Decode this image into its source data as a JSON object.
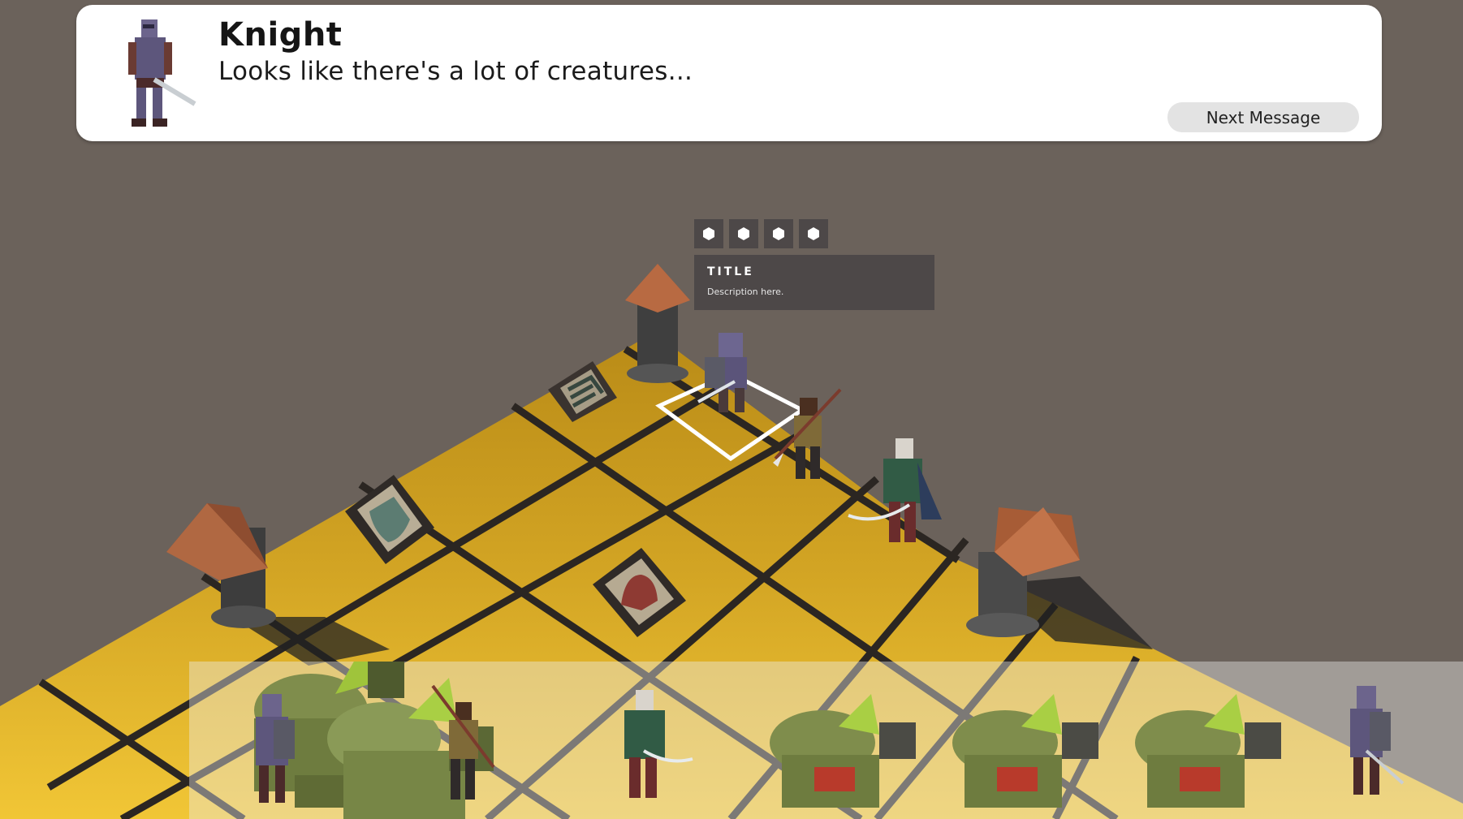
{
  "dialog": {
    "speaker": "Knight",
    "message": "Looks like there's a lot of creatures...",
    "next_label": "Next Message",
    "portrait_icon": "knight-portrait-icon"
  },
  "tooltip": {
    "title": "TITLE",
    "description": "Description here.",
    "stat_slots": [
      "hexagon-icon",
      "hexagon-icon",
      "hexagon-icon",
      "hexagon-icon"
    ]
  },
  "turn_order": [
    {
      "unit": "goblin-brute"
    },
    {
      "unit": "knight"
    },
    {
      "unit": "goblin-brute"
    },
    {
      "unit": "spearman"
    },
    {
      "unit": "elf-swordsman"
    },
    {
      "unit": "goblin-brute"
    },
    {
      "unit": "goblin-brute"
    },
    {
      "unit": "goblin-brute"
    },
    {
      "unit": "knight"
    }
  ],
  "board": {
    "tiles": [
      "defense-rank-tile",
      "shield-tile",
      "arch-tile"
    ],
    "pillars": [
      "brazier-pillar-top",
      "brazier-pillar-left",
      "brazier-pillar-right"
    ],
    "units": [
      "knight",
      "spearman",
      "elf-swordsman"
    ],
    "colors": {
      "background": "#6b625b",
      "board_yellow": "#c9981f",
      "board_lines": "#2b2622",
      "selection": "#ffffff",
      "panel": "#4d4848"
    }
  }
}
